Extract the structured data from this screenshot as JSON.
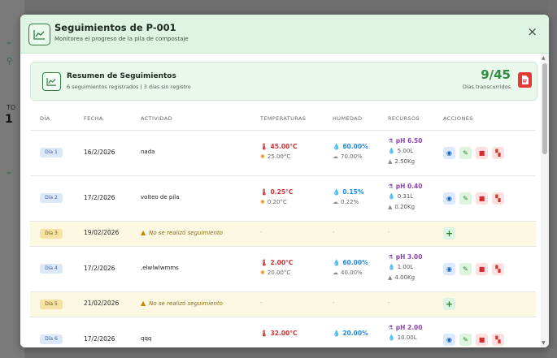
{
  "background": {
    "label_partial": "TO",
    "number_partial": "1"
  },
  "modal": {
    "title": "Seguimientos de P-001",
    "subtitle": "Monitorea el progreso de la pila de compostaje",
    "close_label": "×",
    "accent_color": "#2e8b43"
  },
  "summary": {
    "title": "Resumen de Seguimientos",
    "subtitle": "6 seguimientos registrados | 3 días sin registro",
    "count": "9/45",
    "count_label": "Días transcurridos"
  },
  "table": {
    "headers": [
      "DÍA",
      "FECHA",
      "ACTIVIDAD",
      "TEMPERATURAS",
      "HUMEDAD",
      "RECURSOS",
      "ACCIONES"
    ],
    "rows": [
      {
        "day": "Día 1",
        "date": "16/2/2026",
        "activity": "nada",
        "temp_main": "45.00°C",
        "temp_amb": "25.00°C",
        "hum_main": "60.00%",
        "hum_amb": "70.00%",
        "ph": "pH 6.50",
        "water": "5.00L",
        "weight": "2.50Kg"
      },
      {
        "day": "Día 2",
        "date": "17/2/2026",
        "activity": "volteo de pila",
        "temp_main": "0.25°C",
        "temp_amb": "0.20°C",
        "hum_main": "0.15%",
        "hum_amb": "0.22%",
        "ph": "pH 0.40",
        "water": "0.31L",
        "weight": "0.20Kg"
      },
      {
        "day": "Día 3",
        "date": "19/02/2026",
        "missing": "No se realizó seguimiento",
        "dash": "-"
      },
      {
        "day": "Día 4",
        "date": "17/2/2026",
        "activity": ",elwlwlwmms",
        "temp_main": "2.00°C",
        "temp_amb": "20.00°C",
        "hum_main": "60.00%",
        "hum_amb": "40.00%",
        "ph": "pH 3.00",
        "water": "1.00L",
        "weight": "4.00Kg"
      },
      {
        "day": "Día 5",
        "date": "21/02/2026",
        "missing": "No se realizó seguimiento",
        "dash": "-"
      },
      {
        "day": "Día 6",
        "date": "17/2/2026",
        "activity": "qqq",
        "temp_main": "32.00°C",
        "temp_amb": "",
        "hum_main": "20.00%",
        "hum_amb": "",
        "ph": "pH 2.00",
        "water": "10.00L",
        "weight": ""
      }
    ]
  }
}
